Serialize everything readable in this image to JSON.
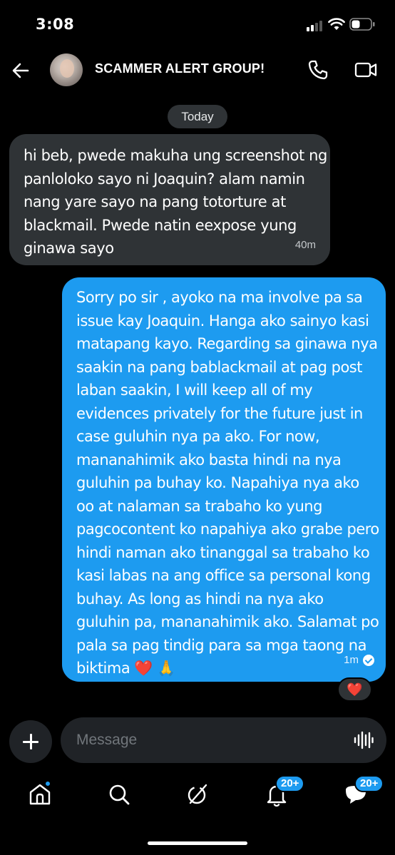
{
  "status_bar": {
    "time": "3:08"
  },
  "header": {
    "title": "SCAMMER ALERT GROUP!",
    "back_icon": "arrow-left-icon",
    "call_icon": "phone-icon",
    "video_icon": "video-camera-icon"
  },
  "conversation": {
    "date_label": "Today",
    "messages": [
      {
        "direction": "incoming",
        "text": "hi beb, pwede makuha ung screenshot ng panloloko sayo ni Joaquin? alam namin nang yare sayo na pang totorture at blackmail. Pwede natin eexpose yung ginawa sayo",
        "time": "40m"
      },
      {
        "direction": "outgoing",
        "text": "Sorry po sir , ayoko na ma involve pa sa issue kay Joaquin. Hanga ako sainyo kasi matapang kayo. Regarding sa ginawa nya saakin na pang bablackmail at pag post laban saakin, I will keep all of my evidences privately for the future just in case guluhin nya pa ako. For now, mananahimik ako basta hindi na nya guluhin pa buhay ko. Napahiya nya ako oo at nalaman sa trabaho ko yung pagcocontent ko napahiya ako grabe pero hindi naman ako tinanggal sa trabaho ko kasi labas na ang office sa personal kong buhay. As long as hindi na nya ako guluhin pa, mananahimik ako. Salamat po pala sa pag tindig para sa mga taong na biktima",
        "emoji": "❤️ 🙏",
        "time": "1m",
        "read_icon": "check-circle-icon",
        "reaction": "❤️"
      }
    ]
  },
  "composer": {
    "placeholder": "Message",
    "add_icon": "plus-icon",
    "voice_icon": "voice-wave-icon"
  },
  "bottom_nav": {
    "items": [
      {
        "name": "home",
        "icon": "home-icon",
        "has_dot": true
      },
      {
        "name": "search",
        "icon": "search-icon"
      },
      {
        "name": "grok",
        "icon": "grok-icon"
      },
      {
        "name": "notifications",
        "icon": "bell-icon",
        "badge": "20+"
      },
      {
        "name": "messages",
        "icon": "envelope-icon",
        "badge": "20+"
      }
    ]
  },
  "colors": {
    "background": "#000000",
    "incoming_bubble": "#2f3336",
    "outgoing_bubble": "#1d9bf0",
    "accent": "#1d9bf0",
    "muted_text": "#71767b"
  }
}
